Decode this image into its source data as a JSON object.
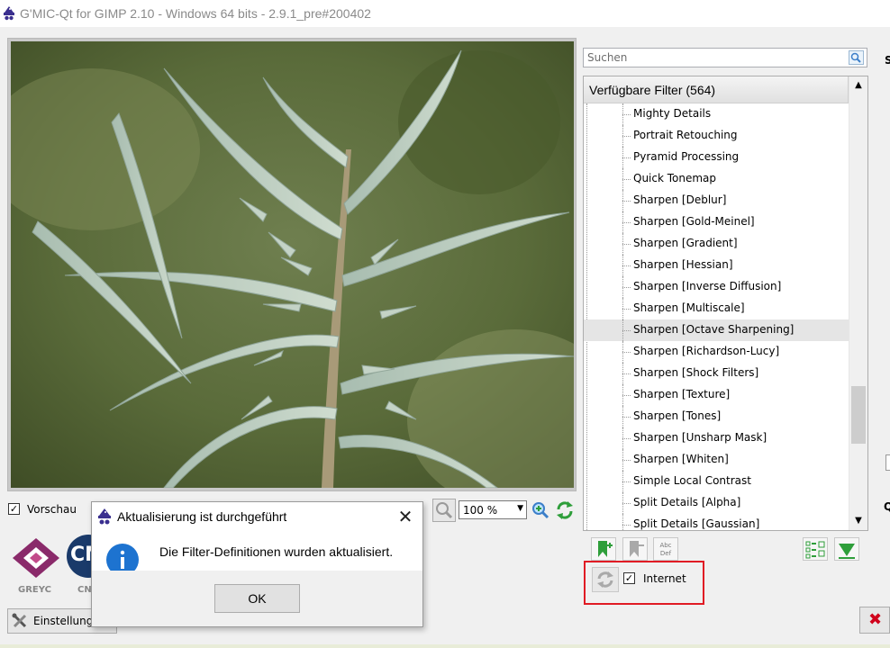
{
  "window": {
    "title": "G'MIC-Qt for GIMP 2.10 - Windows 64 bits - 2.9.1_pre#200402"
  },
  "preview": {
    "checkbox_label": "Vorschau",
    "checked": true,
    "zoom_value": "100 %",
    "settings_label": "Einstellungen"
  },
  "logos": {
    "greyc": "GREYC",
    "cnrs": "CN",
    "cnrs_caption": "CN"
  },
  "dialog": {
    "title": "Aktualisierung ist durchgeführt",
    "message": "Die Filter-Definitionen wurden aktualisiert.",
    "ok_label": "OK",
    "close_glyph": "✕"
  },
  "filters": {
    "search_placeholder": "Suchen",
    "header": "Verfügbare Filter (564)",
    "items": [
      {
        "label": "Mighty Details"
      },
      {
        "label": "Portrait Retouching"
      },
      {
        "label": "Pyramid Processing"
      },
      {
        "label": "Quick Tonemap"
      },
      {
        "label": "Sharpen [Deblur]"
      },
      {
        "label": "Sharpen [Gold-Meinel]"
      },
      {
        "label": "Sharpen [Gradient]"
      },
      {
        "label": "Sharpen [Hessian]"
      },
      {
        "label": "Sharpen [Inverse Diffusion]"
      },
      {
        "label": "Sharpen [Multiscale]"
      },
      {
        "label": "Sharpen [Octave Sharpening]",
        "selected": true
      },
      {
        "label": "Sharpen [Richardson-Lucy]"
      },
      {
        "label": "Sharpen [Shock Filters]"
      },
      {
        "label": "Sharpen [Texture]"
      },
      {
        "label": "Sharpen [Tones]"
      },
      {
        "label": "Sharpen [Unsharp Mask]"
      },
      {
        "label": "Sharpen [Whiten]"
      },
      {
        "label": "Simple Local Contrast"
      },
      {
        "label": "Split Details [Alpha]"
      },
      {
        "label": "Split Details [Gaussian]"
      }
    ],
    "internet_label": "Internet",
    "internet_checked": true,
    "rename_icon_text": "Abc Def"
  },
  "edge": {
    "s_label": "S",
    "q_label": "Q"
  },
  "colors": {
    "highlight": "#e01b24",
    "accent_green": "#2e9e3a",
    "selection": "#e5e5e5"
  }
}
